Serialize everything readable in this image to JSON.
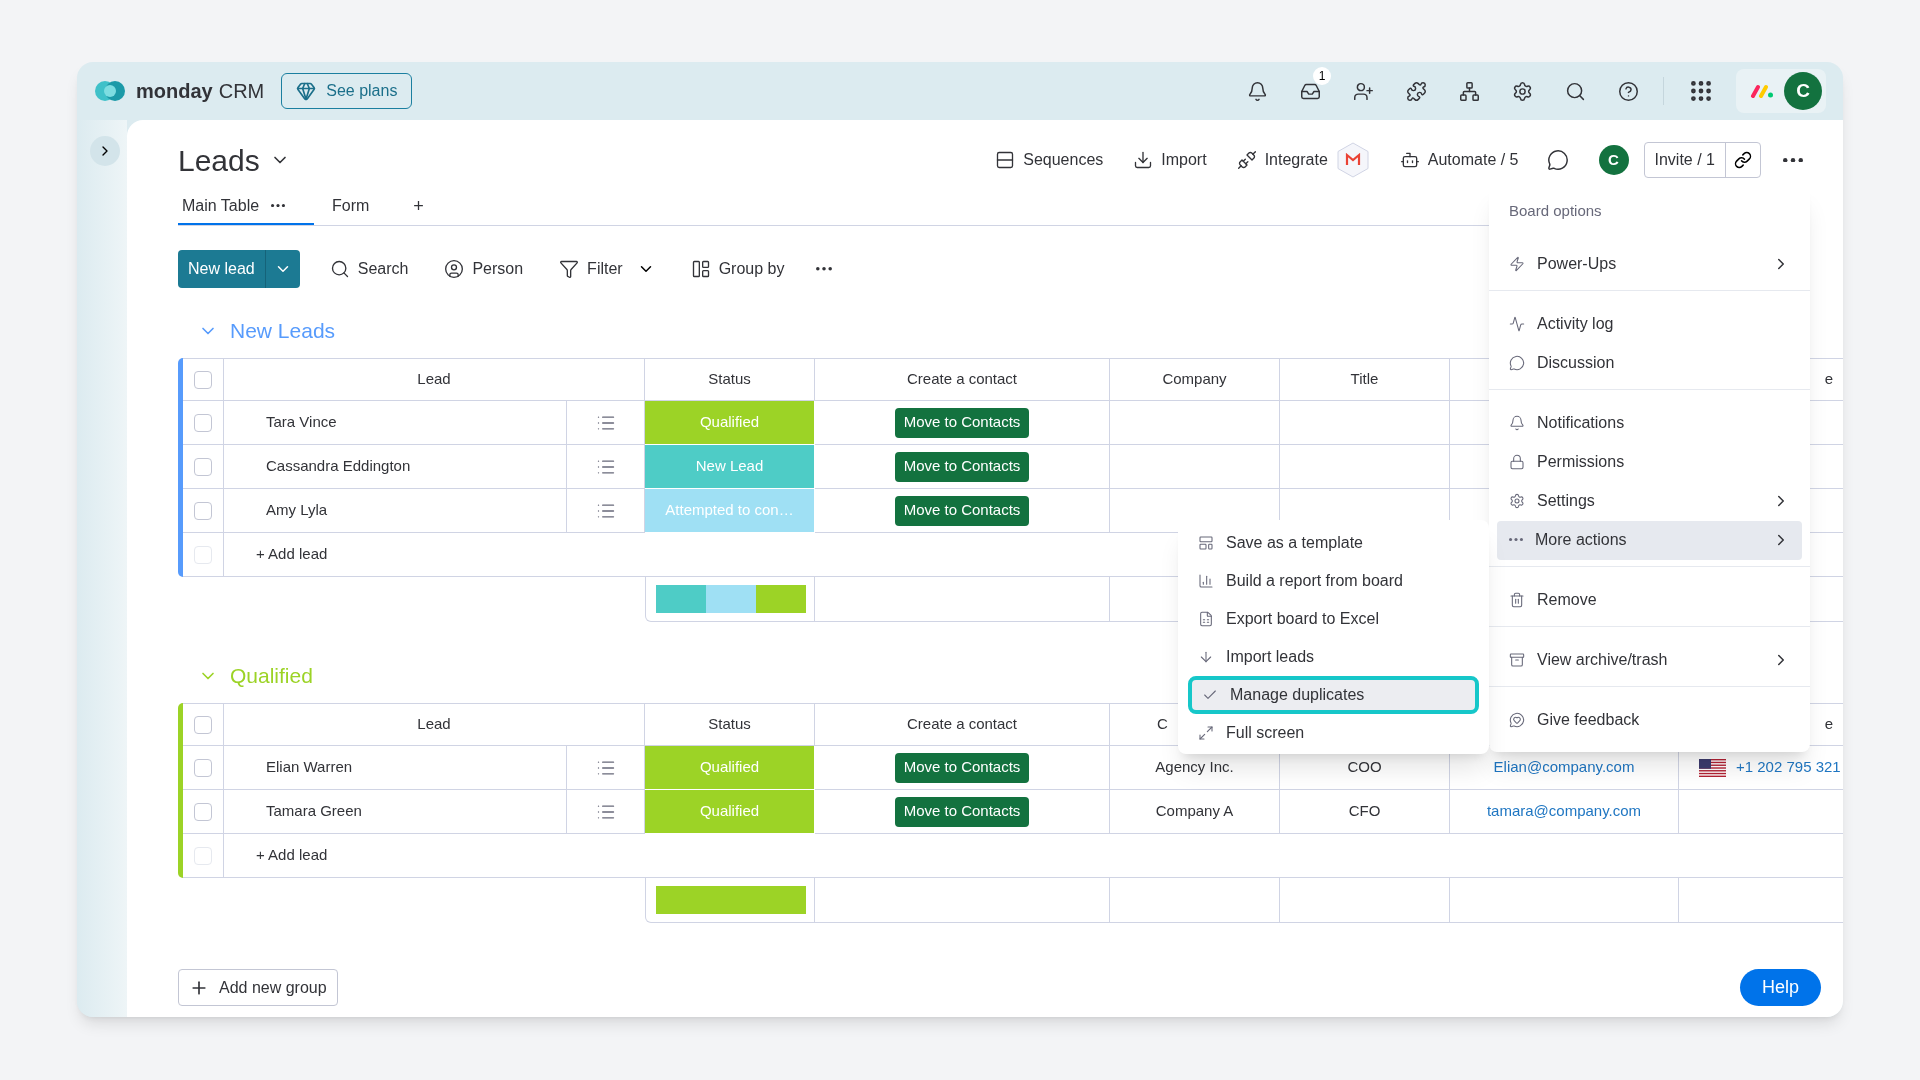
{
  "topbar": {
    "brand": "monday",
    "product": "CRM",
    "plans_button": "See plans",
    "inbox_badge": "1",
    "avatar": "C"
  },
  "board": {
    "title": "Leads",
    "views": [
      {
        "label": "Main Table",
        "selected": true
      },
      {
        "label": "Form",
        "selected": false
      }
    ],
    "add_view": "+"
  },
  "header_actions": [
    "Sequences",
    "Import",
    "Integrate",
    "Automate / 5"
  ],
  "header_avatar": "C",
  "invite": "Invite / 1",
  "toolbar": {
    "new_button": "New lead",
    "items": [
      "Search",
      "Person",
      "Filter",
      "Group by"
    ]
  },
  "groups": [
    {
      "title": "New Leads",
      "color": "#579bfc",
      "all_checked": false,
      "columns": [
        {
          "label": "Lead",
          "kind": "full"
        },
        {
          "label": "Status",
          "kind": "full"
        },
        {
          "label": "Create a contact",
          "kind": "full"
        },
        {
          "label": "Company",
          "kind": "full"
        },
        {
          "label": "Title",
          "kind": "full"
        },
        {
          "kind": "hidden"
        },
        {
          "label": "e",
          "kind": "tail"
        }
      ],
      "rows": [
        {
          "checked": false,
          "lead": "Tara Vince",
          "status": {
            "label": "Qualified",
            "color": "#9cd326"
          },
          "action": "Move to Contacts"
        },
        {
          "checked": false,
          "lead": "Cassandra Eddington",
          "status": {
            "label": "New Lead",
            "color": "#4eccc6"
          },
          "action": "Move to Contacts"
        },
        {
          "checked": false,
          "lead": "Amy Lyla",
          "status": {
            "label": "Attempted to con…",
            "color": "#9fe0f4"
          },
          "action": "Move to Contacts"
        }
      ],
      "add_row": "+ Add lead",
      "add_row_checked": false,
      "summary": [
        {
          "color": "#4eccc6"
        },
        {
          "color": "#9fe0f4"
        },
        {
          "color": "#9cd326"
        }
      ]
    },
    {
      "title": "Qualified",
      "color": "#9cd326",
      "all_checked": false,
      "columns": [
        {
          "label": "Lead",
          "kind": "full"
        },
        {
          "label": "Status",
          "kind": "full"
        },
        {
          "label": "Create a contact",
          "kind": "full"
        },
        {
          "label": "C",
          "kind": "head"
        },
        {
          "kind": "hidden"
        },
        {
          "kind": "hidden"
        },
        {
          "label": "e",
          "kind": "tail"
        }
      ],
      "rows": [
        {
          "checked": false,
          "lead": "Elian Warren",
          "status": {
            "label": "Qualified",
            "color": "#9cd326"
          },
          "action": "Move to Contacts",
          "company": "Agency Inc.",
          "title": "COO",
          "email": "Elian@company.com",
          "phone": "+1 202 795 321"
        },
        {
          "checked": false,
          "lead": "Tamara Green",
          "status": {
            "label": "Qualified",
            "color": "#9cd326"
          },
          "action": "Move to Contacts",
          "company": "Company A",
          "title": "CFO",
          "email": "tamara@company.com"
        }
      ],
      "add_row": "+ Add lead",
      "add_row_checked": false,
      "summary": [
        {
          "color": "#9cd326"
        }
      ]
    }
  ],
  "add_group": "Add new group",
  "help": "Help",
  "menu": {
    "heading": "Board options",
    "sections": [
      [
        {
          "label": "Power-Ups",
          "submenu": true,
          "selected": false
        }
      ],
      [
        {
          "label": "Activity log",
          "submenu": false,
          "selected": false
        },
        {
          "label": "Discussion",
          "submenu": false,
          "selected": false
        }
      ],
      [
        {
          "label": "Notifications",
          "submenu": false,
          "selected": false
        },
        {
          "label": "Permissions",
          "submenu": false,
          "selected": false
        },
        {
          "label": "Settings",
          "submenu": true,
          "selected": false
        },
        {
          "label": "More actions",
          "submenu": true,
          "selected": true
        }
      ],
      [
        {
          "label": "Remove",
          "submenu": false,
          "selected": false
        }
      ],
      [
        {
          "label": "View archive/trash",
          "submenu": true,
          "selected": false
        }
      ],
      [
        {
          "label": "Give feedback",
          "submenu": false,
          "selected": false
        }
      ]
    ]
  },
  "submenu": {
    "items": [
      {
        "label": "Save as a template",
        "selected": false,
        "highlighted": false
      },
      {
        "label": "Build a report from board",
        "selected": false,
        "highlighted": false
      },
      {
        "label": "Export board to Excel",
        "selected": false,
        "highlighted": false
      },
      {
        "label": "Import leads",
        "selected": false,
        "highlighted": false
      },
      {
        "label": "Manage duplicates",
        "selected": true,
        "highlighted": true
      },
      {
        "label": "Full screen",
        "selected": false,
        "highlighted": false
      }
    ]
  }
}
